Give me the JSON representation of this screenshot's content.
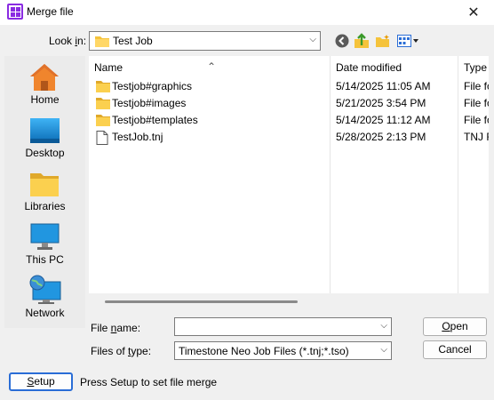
{
  "window": {
    "title": "Merge file",
    "close_glyph": "✕"
  },
  "look_in": {
    "label_pre": "Look ",
    "label_key": "i",
    "label_post": "n:",
    "value": "Test Job"
  },
  "places": [
    {
      "id": "home",
      "label": "Home",
      "icon": "home-icon"
    },
    {
      "id": "desktop",
      "label": "Desktop",
      "icon": "desktop-icon"
    },
    {
      "id": "libraries",
      "label": "Libraries",
      "icon": "libraries-icon"
    },
    {
      "id": "thispc",
      "label": "This PC",
      "icon": "computer-icon"
    },
    {
      "id": "network",
      "label": "Network",
      "icon": "network-icon"
    }
  ],
  "file_list": {
    "columns": {
      "name": "Name",
      "date": "Date modified",
      "type": "Type"
    },
    "rows": [
      {
        "name": "Testjob#graphics",
        "date": "5/14/2025 11:05 AM",
        "type": "File fo",
        "kind": "folder"
      },
      {
        "name": "Testjob#images",
        "date": "5/21/2025 3:54 PM",
        "type": "File fo",
        "kind": "folder"
      },
      {
        "name": "Testjob#templates",
        "date": "5/14/2025 11:12 AM",
        "type": "File fo",
        "kind": "folder"
      },
      {
        "name": "TestJob.tnj",
        "date": "5/28/2025 2:13 PM",
        "type": "TNJ Fi",
        "kind": "file"
      }
    ]
  },
  "file_name": {
    "label_pre": "File ",
    "label_key": "n",
    "label_post": "ame:",
    "value": ""
  },
  "files_of_type": {
    "label_pre": "Files of ",
    "label_key": "t",
    "label_post": "ype:",
    "value": "Timestone Neo Job Files  (*.tnj;*.tso)"
  },
  "buttons": {
    "open_key": "O",
    "open_rest": "pen",
    "cancel": "Cancel",
    "setup_key": "S",
    "setup_rest": "etup"
  },
  "setup_hint": "Press Setup to set file merge",
  "colors": {
    "folder": "#f5c33b",
    "accent": "#2a6dd6",
    "app_icon": "#8a2be2"
  }
}
